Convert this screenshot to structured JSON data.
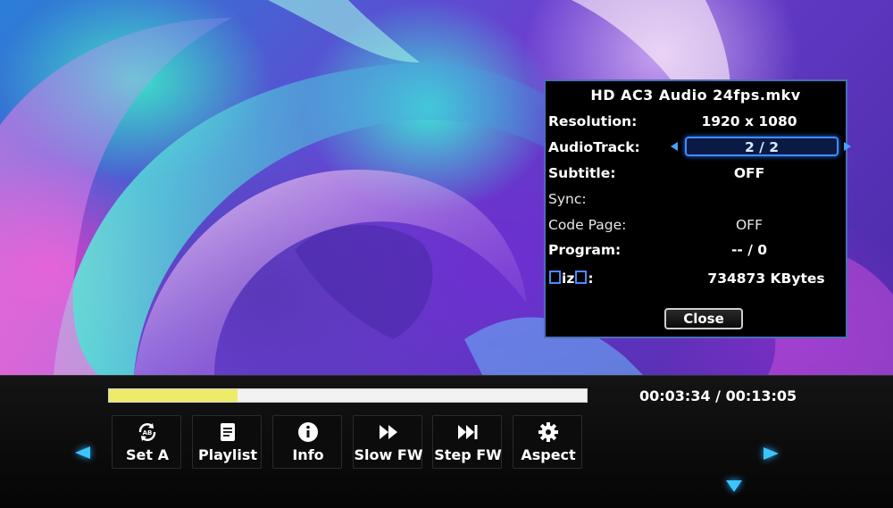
{
  "info": {
    "title": "HD AC3 Audio 24fps.mkv",
    "rows": [
      {
        "label": "Resolution:",
        "value": "1920 x 1080"
      },
      {
        "label": "AudioTrack:",
        "value": "2 / 2"
      },
      {
        "label": "Subtitle:",
        "value": "OFF"
      },
      {
        "label": "Sync:",
        "value": ""
      },
      {
        "label": "Code Page:",
        "value": "OFF"
      },
      {
        "label": "Program:",
        "value": "-- / 0"
      },
      {
        "label_mid": "iz",
        "label_end": ":",
        "value": "734873  KBytes"
      }
    ],
    "close_label": "Close"
  },
  "player": {
    "progress_fraction": 0.27,
    "time": "00:03:34 / 00:13:05",
    "buttons": [
      {
        "label": "Set  A",
        "icon": "ab-repeat-icon"
      },
      {
        "label": "Playlist",
        "icon": "playlist-icon"
      },
      {
        "label": "Info",
        "icon": "info-icon"
      },
      {
        "label": "Slow  FW",
        "icon": "slow-forward-icon"
      },
      {
        "label": "Step  FW",
        "icon": "step-forward-icon"
      },
      {
        "label": "Aspect",
        "icon": "gear-icon"
      }
    ]
  },
  "colors": {
    "accent": "#3cc4ff",
    "progress_fill": "#eeea6a",
    "dialog_border": "#4a6fb8"
  }
}
